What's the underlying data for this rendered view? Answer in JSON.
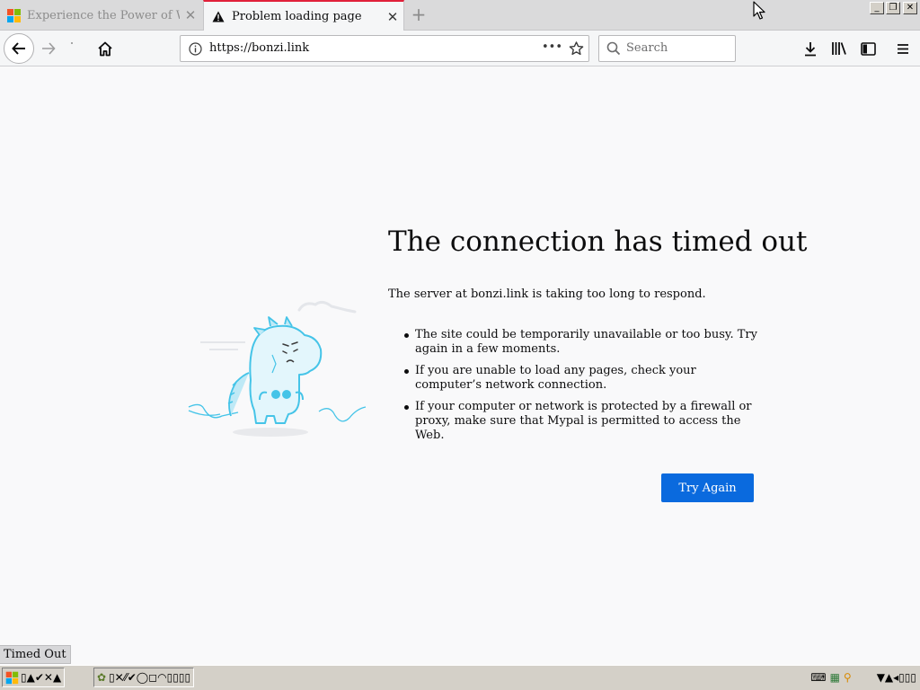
{
  "tabs": [
    {
      "title": "Experience the Power of Wi",
      "icon": "microsoft-logo-icon",
      "active": false
    },
    {
      "title": "Problem loading page",
      "icon": "warning-icon",
      "active": true
    }
  ],
  "navbar": {
    "url": "https://bonzi.link",
    "search_placeholder": "Search",
    "page_actions": "•••"
  },
  "error": {
    "title": "The connection has timed out",
    "description": "The server at bonzi.link is taking too long to respond.",
    "items": [
      "The site could be temporarily unavailable or too busy. Try again in a few moments.",
      "If you are unable to load any pages, check your computer’s network connection.",
      "If your computer or network is protected by a firewall or proxy, make sure that Mypal is permitted to access the Web."
    ],
    "button": "Try Again"
  },
  "status": "Timed Out",
  "taskbar": {
    "group1": "▯▲✔✕▲",
    "group2": "▯✕⁄⁄✔◯◻◠▯▯▯▯",
    "tray_text": "▼▲◂▯▯▯"
  },
  "colors": {
    "accent": "#0a6ade",
    "tab_highlight": "#e0203a",
    "illustration": "#45c4e8"
  }
}
